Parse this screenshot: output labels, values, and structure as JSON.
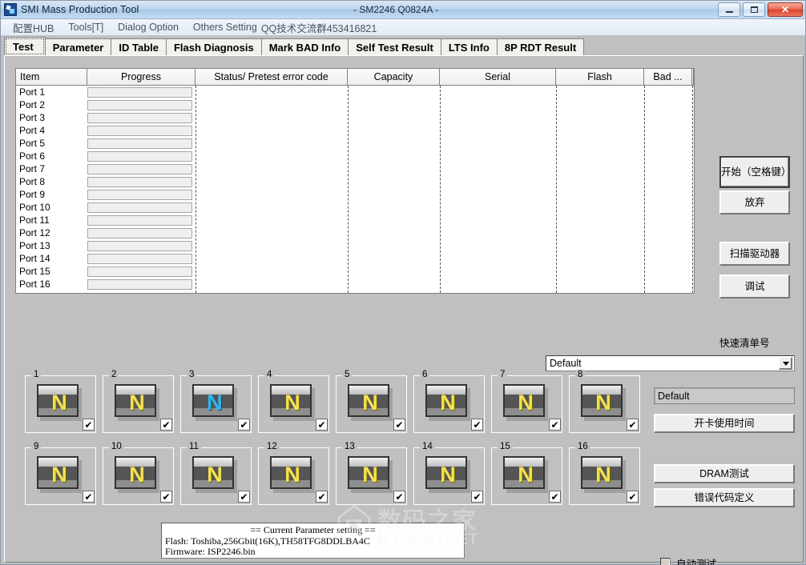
{
  "window": {
    "title": "SMI Mass Production Tool",
    "subtitle": "- SM2246 Q0824A -",
    "minimize_label": "",
    "maximize_label": "",
    "close_label": "✕"
  },
  "menu": {
    "items": [
      {
        "label": "配置HUB"
      },
      {
        "label": "Tools[T]"
      },
      {
        "label": "Dialog Option"
      },
      {
        "label": "Others Setting"
      },
      {
        "label": "QQ技术交流群453416821"
      }
    ]
  },
  "tabs": [
    {
      "label": "Test",
      "active": true
    },
    {
      "label": "Parameter",
      "active": false
    },
    {
      "label": "ID Table",
      "active": false
    },
    {
      "label": "Flash Diagnosis",
      "active": false
    },
    {
      "label": "Mark BAD Info",
      "active": false
    },
    {
      "label": "Self Test Result",
      "active": false
    },
    {
      "label": "LTS Info",
      "active": false
    },
    {
      "label": "8P RDT Result",
      "active": false
    }
  ],
  "grid": {
    "headers": [
      "Item",
      "Progress",
      "Status/ Pretest error code",
      "Capacity",
      "Serial",
      "Flash",
      "Bad ..."
    ],
    "rows": [
      {
        "item": "Port 1",
        "progress": "",
        "status": "",
        "capacity": "",
        "serial": "",
        "flash": "",
        "bad": ""
      },
      {
        "item": "Port 2",
        "progress": "",
        "status": "",
        "capacity": "",
        "serial": "",
        "flash": "",
        "bad": ""
      },
      {
        "item": "Port 3",
        "progress": "",
        "status": "",
        "capacity": "",
        "serial": "",
        "flash": "",
        "bad": ""
      },
      {
        "item": "Port 4",
        "progress": "",
        "status": "",
        "capacity": "",
        "serial": "",
        "flash": "",
        "bad": ""
      },
      {
        "item": "Port 5",
        "progress": "",
        "status": "",
        "capacity": "",
        "serial": "",
        "flash": "",
        "bad": ""
      },
      {
        "item": "Port 6",
        "progress": "",
        "status": "",
        "capacity": "",
        "serial": "",
        "flash": "",
        "bad": ""
      },
      {
        "item": "Port 7",
        "progress": "",
        "status": "",
        "capacity": "",
        "serial": "",
        "flash": "",
        "bad": ""
      },
      {
        "item": "Port 8",
        "progress": "",
        "status": "",
        "capacity": "",
        "serial": "",
        "flash": "",
        "bad": ""
      },
      {
        "item": "Port 9",
        "progress": "",
        "status": "",
        "capacity": "",
        "serial": "",
        "flash": "",
        "bad": ""
      },
      {
        "item": "Port 10",
        "progress": "",
        "status": "",
        "capacity": "",
        "serial": "",
        "flash": "",
        "bad": ""
      },
      {
        "item": "Port 11",
        "progress": "",
        "status": "",
        "capacity": "",
        "serial": "",
        "flash": "",
        "bad": ""
      },
      {
        "item": "Port 12",
        "progress": "",
        "status": "",
        "capacity": "",
        "serial": "",
        "flash": "",
        "bad": ""
      },
      {
        "item": "Port 13",
        "progress": "",
        "status": "",
        "capacity": "",
        "serial": "",
        "flash": "",
        "bad": ""
      },
      {
        "item": "Port 14",
        "progress": "",
        "status": "",
        "capacity": "",
        "serial": "",
        "flash": "",
        "bad": ""
      },
      {
        "item": "Port 15",
        "progress": "",
        "status": "",
        "capacity": "",
        "serial": "",
        "flash": "",
        "bad": ""
      },
      {
        "item": "Port 16",
        "progress": "",
        "status": "",
        "capacity": "",
        "serial": "",
        "flash": "",
        "bad": ""
      }
    ]
  },
  "commands": {
    "start": "开始（空格键）",
    "abort": "放弃",
    "scan_drive": "扫描驱动器",
    "debug": "调试",
    "quick_list_label": "快速清单号"
  },
  "combo": {
    "value": "Default",
    "arrow_icon": "chevron-down-icon"
  },
  "side": {
    "default_field": "Default",
    "card_time": "开卡使用时间",
    "dram_test": "DRAM测试",
    "error_code_def": "错误代码定义"
  },
  "auto_test": {
    "label": "自动测试",
    "checked": false
  },
  "devices": [
    {
      "id": "1",
      "letter": "N",
      "color": "yellow",
      "checked": true
    },
    {
      "id": "2",
      "letter": "N",
      "color": "yellow",
      "checked": true
    },
    {
      "id": "3",
      "letter": "N",
      "color": "blue",
      "checked": true
    },
    {
      "id": "4",
      "letter": "N",
      "color": "yellow",
      "checked": true
    },
    {
      "id": "5",
      "letter": "N",
      "color": "yellow",
      "checked": true
    },
    {
      "id": "6",
      "letter": "N",
      "color": "yellow",
      "checked": true
    },
    {
      "id": "7",
      "letter": "N",
      "color": "yellow",
      "checked": true
    },
    {
      "id": "8",
      "letter": "N",
      "color": "yellow",
      "checked": true
    },
    {
      "id": "9",
      "letter": "N",
      "color": "yellow",
      "checked": true
    },
    {
      "id": "10",
      "letter": "N",
      "color": "yellow",
      "checked": true
    },
    {
      "id": "11",
      "letter": "N",
      "color": "yellow",
      "checked": true
    },
    {
      "id": "12",
      "letter": "N",
      "color": "yellow",
      "checked": true
    },
    {
      "id": "13",
      "letter": "N",
      "color": "yellow",
      "checked": true
    },
    {
      "id": "14",
      "letter": "N",
      "color": "yellow",
      "checked": true
    },
    {
      "id": "15",
      "letter": "N",
      "color": "yellow",
      "checked": true
    },
    {
      "id": "16",
      "letter": "N",
      "color": "yellow",
      "checked": true
    }
  ],
  "param_info": {
    "heading": "== Current Parameter setting ==",
    "flash_line": "Flash:   Toshiba,256Gbit(16K),TH58TFG8DDLBA4C",
    "firmware_line": "Firmware:   ISP2246.bin"
  },
  "watermark": {
    "cn": "数码之家",
    "en": "MYDIGIT.NET"
  },
  "checkmark_glyph": "✔"
}
